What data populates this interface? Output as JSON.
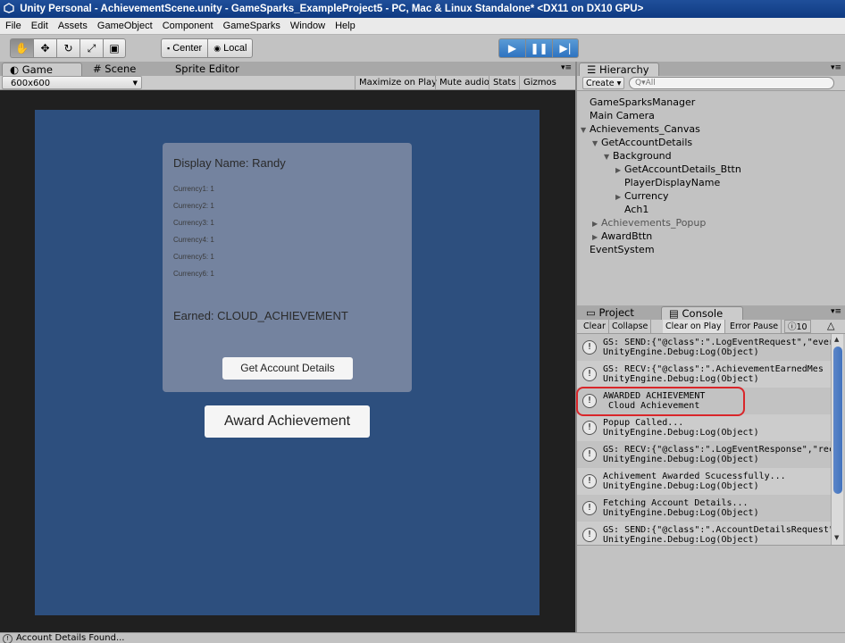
{
  "window": {
    "title": "Unity Personal - AchievementScene.unity - GameSparks_ExampleProject5 - PC, Mac & Linux Standalone* <DX11 on DX10 GPU>"
  },
  "menu": [
    "File",
    "Edit",
    "Assets",
    "GameObject",
    "Component",
    "GameSparks",
    "Window",
    "Help"
  ],
  "toolbar": {
    "tools": [
      "hand-tool",
      "move-tool",
      "rotate-tool",
      "scale-tool",
      "rect-tool"
    ],
    "pivot_mode": "Center",
    "pivot_space": "Local"
  },
  "game": {
    "tabs": [
      "Game",
      "Scene",
      "Sprite Editor"
    ],
    "resolution": "600x600",
    "options": [
      "Maximize on Play",
      "Mute audio",
      "Stats",
      "Gizmos"
    ],
    "display_name": "Display Name: Randy",
    "currencies": [
      "Currency1: 1",
      "Currency2: 1",
      "Currency3: 1",
      "Currency4: 1",
      "Currency5: 1",
      "Currency6: 1"
    ],
    "earned": "Earned: CLOUD_ACHIEVEMENT",
    "get_account_details_label": "Get Account Details",
    "award_achievement_label": "Award Achievement",
    "colors": {
      "background": "#202020",
      "canvas": "#2d4f7e",
      "panel": "#74839f"
    }
  },
  "hierarchy": {
    "title": "Hierarchy",
    "create_label": "Create",
    "search_placeholder": "Q▾All",
    "items": [
      {
        "label": "GameSparksManager",
        "depth": 0,
        "arrow": "",
        "dim": false
      },
      {
        "label": "Main Camera",
        "depth": 0,
        "arrow": "",
        "dim": false
      },
      {
        "label": "Achievements_Canvas",
        "depth": 0,
        "arrow": "▼",
        "dim": false
      },
      {
        "label": "GetAccountDetails",
        "depth": 1,
        "arrow": "▼",
        "dim": false
      },
      {
        "label": "Background",
        "depth": 2,
        "arrow": "▼",
        "dim": false
      },
      {
        "label": "GetAccountDetails_Bttn",
        "depth": 3,
        "arrow": "▶",
        "dim": false
      },
      {
        "label": "PlayerDisplayName",
        "depth": 3,
        "arrow": "",
        "dim": false
      },
      {
        "label": "Currency",
        "depth": 3,
        "arrow": "▶",
        "dim": false
      },
      {
        "label": "Ach1",
        "depth": 3,
        "arrow": "",
        "dim": false
      },
      {
        "label": "Achievements_Popup",
        "depth": 1,
        "arrow": "▶",
        "dim": true
      },
      {
        "label": "AwardBttn",
        "depth": 1,
        "arrow": "▶",
        "dim": false
      },
      {
        "label": "EventSystem",
        "depth": 0,
        "arrow": "",
        "dim": false
      }
    ]
  },
  "console": {
    "tabs": [
      "Project",
      "Console"
    ],
    "buttons": [
      "Clear",
      "Collapse",
      "Clear on Play",
      "Error Pause"
    ],
    "log_count": "10",
    "entries": [
      {
        "line1": "GS: SEND:{\"@class\":\".LogEventRequest\",\"ever",
        "line2": "UnityEngine.Debug:Log(Object)"
      },
      {
        "line1": "GS: RECV:{\"@class\":\".AchievementEarnedMes",
        "line2": "UnityEngine.Debug:Log(Object)"
      },
      {
        "line1": "AWARDED ACHIEVEMENT",
        "line2": "Cloud Achievement"
      },
      {
        "line1": "Popup Called...",
        "line2": "UnityEngine.Debug:Log(Object)"
      },
      {
        "line1": "GS: RECV:{\"@class\":\".LogEventResponse\",\"rec",
        "line2": "UnityEngine.Debug:Log(Object)"
      },
      {
        "line1": "Achivement Awarded Scucessfully...",
        "line2": "UnityEngine.Debug:Log(Object)"
      },
      {
        "line1": "Fetching Account Details...",
        "line2": "UnityEngine.Debug:Log(Object)"
      },
      {
        "line1": "GS: SEND:{\"@class\":\".AccountDetailsRequest\",",
        "line2": "UnityEngine.Debug:Log(Object)"
      }
    ],
    "highlight_color": "#d9262a"
  },
  "status": {
    "text": "Account Details Found..."
  }
}
